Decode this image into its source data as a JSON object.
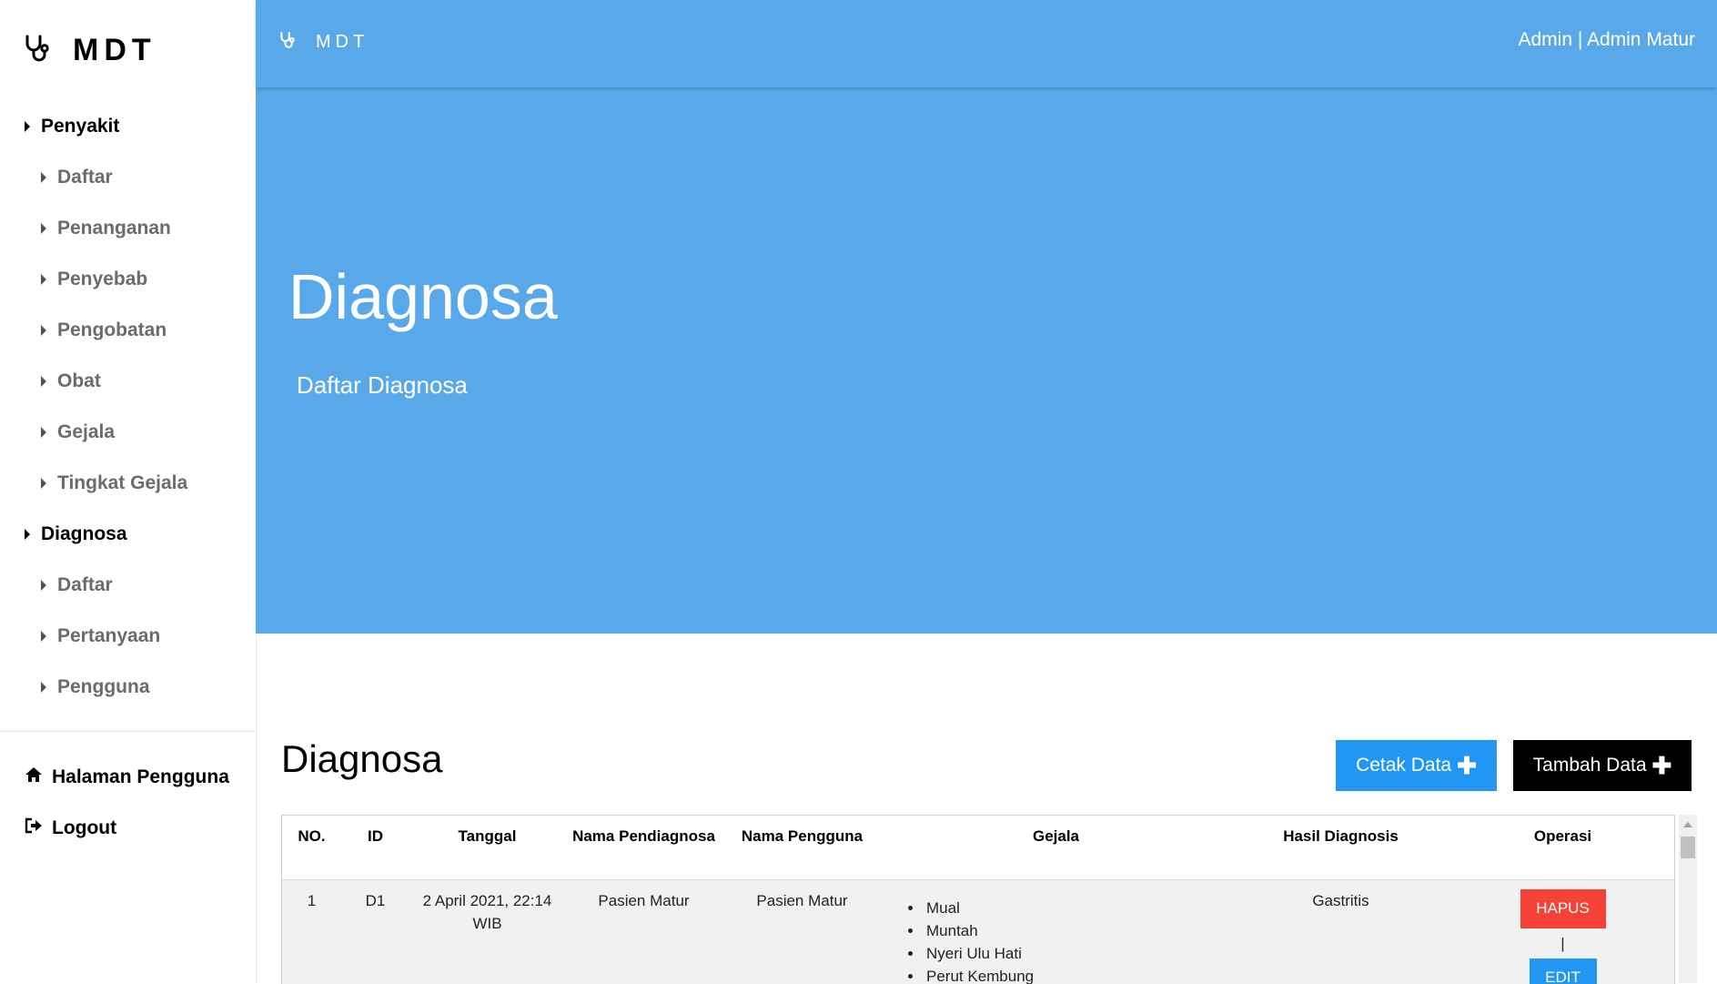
{
  "sidebar": {
    "brand": "MDT",
    "brand_icon": "stethoscope-icon",
    "nav": [
      {
        "label": "Penyakit",
        "level": 1
      },
      {
        "label": "Daftar",
        "level": 2
      },
      {
        "label": "Penanganan",
        "level": 2
      },
      {
        "label": "Penyebab",
        "level": 2
      },
      {
        "label": "Pengobatan",
        "level": 2
      },
      {
        "label": "Obat",
        "level": 2
      },
      {
        "label": "Gejala",
        "level": 2
      },
      {
        "label": "Tingkat Gejala",
        "level": 2
      },
      {
        "label": "Diagnosa",
        "level": 1
      },
      {
        "label": "Daftar",
        "level": 2
      },
      {
        "label": "Pertanyaan",
        "level": 2
      },
      {
        "label": "Pengguna",
        "level": 2
      }
    ],
    "halaman_pengguna": "Halaman Pengguna",
    "logout": "Logout"
  },
  "header": {
    "brand": "MDT",
    "user": "Admin | Admin Matur",
    "bg_color": "#59a9ea"
  },
  "hero": {
    "title": "Diagnosa",
    "subtitle": "Daftar Diagnosa"
  },
  "content": {
    "title": "Diagnosa",
    "cetak_label": "Cetak Data",
    "tambah_label": "Tambah Data",
    "plus_glyph": "✚"
  },
  "table": {
    "headers": {
      "no": "NO.",
      "id": "ID",
      "tanggal": "Tanggal",
      "nama_pendiagnosa": "Nama Pendiagnosa",
      "nama_pengguna": "Nama Pengguna",
      "gejala": "Gejala",
      "hasil": "Hasil Diagnosis",
      "operasi": "Operasi"
    },
    "rows": [
      {
        "no": "1",
        "id": "D1",
        "tanggal": "2 April 2021, 22:14 WIB",
        "nama_pendiagnosa": "Pasien Matur",
        "nama_pengguna": "Pasien Matur",
        "gejala": [
          "Mual",
          "Muntah",
          "Nyeri Ulu Hati",
          "Perut Kembung"
        ],
        "hasil": "Gastritis",
        "hapus": "HAPUS",
        "separator": "|",
        "edit": "EDIT"
      }
    ]
  },
  "colors": {
    "primary_blue": "#59a9ea",
    "button_blue": "#2196f3",
    "button_red": "#f44336"
  }
}
